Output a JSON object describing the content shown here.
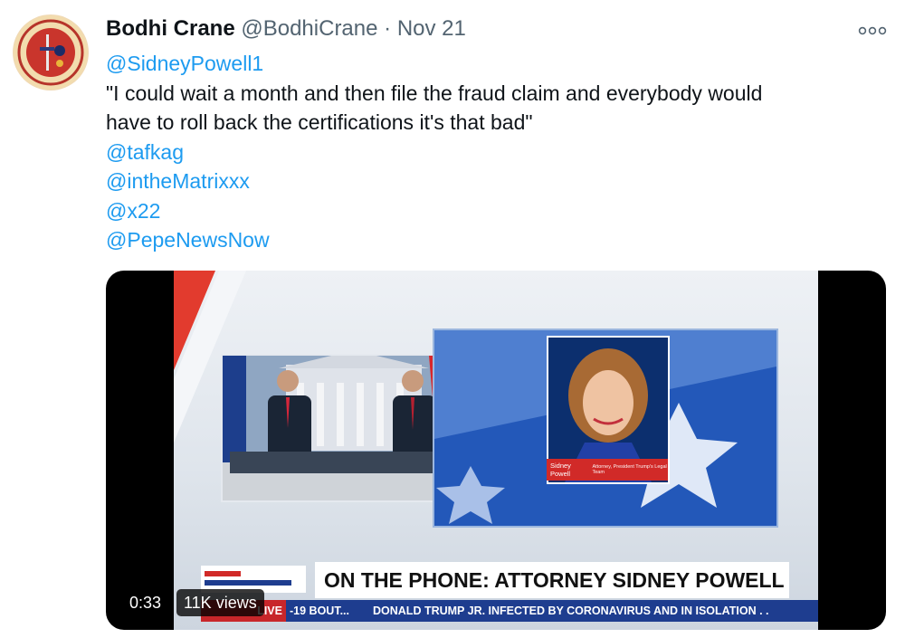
{
  "tweet": {
    "author_name": "Bodhi Crane",
    "author_handle": "@BodhiCrane",
    "separator": "·",
    "date": "Nov 21",
    "text_lines": [
      {
        "kind": "mention",
        "text": "@SidneyPowell1"
      },
      {
        "kind": "quote",
        "text": "\"I could wait a month and then file the fraud claim and everybody would"
      },
      {
        "kind": "quote",
        "text": "have to roll back the certifications it's that bad\""
      },
      {
        "kind": "mention",
        "text": "@tafkag"
      },
      {
        "kind": "mention",
        "text": "@intheMatrixxx"
      },
      {
        "kind": "mention",
        "text": "@x22"
      },
      {
        "kind": "mention",
        "text": "@PepeNewsNow"
      }
    ],
    "more_icon": "more-dots-icon"
  },
  "video": {
    "nameplate_name": "Sidney Powell",
    "nameplate_role": "Attorney, President Trump's Legal Team",
    "lower_third_title": "ON THE PHONE: ATTORNEY SIDNEY POWELL",
    "ticker_live": "LIVE",
    "ticker_bout": "-19 BOUT...",
    "ticker_news": "DONALD TRUMP JR. INFECTED BY CORONAVIRUS AND IN ISOLATION . .",
    "time": "0:33",
    "views": "11K views"
  },
  "colors": {
    "link": "#1d9bf0",
    "muted": "#536471",
    "ticker_blue": "#1e3d8f",
    "ticker_red": "#c8262a"
  }
}
